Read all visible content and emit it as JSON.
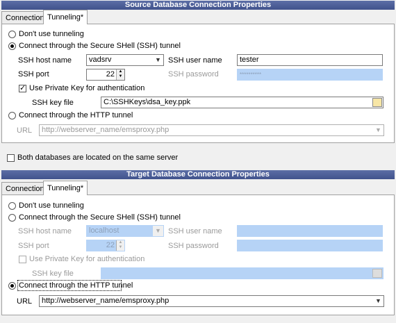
{
  "source": {
    "title": "Source Database Connection Properties",
    "tabs": [
      "Connection",
      "Tunneling*"
    ],
    "options": {
      "no_tunnel": "Don't use tunneling",
      "ssh_tunnel": "Connect through the Secure SHell (SSH) tunnel",
      "http_tunnel": "Connect through the HTTP tunnel"
    },
    "ssh": {
      "host_label": "SSH host name",
      "host_value": "vadsrv",
      "user_label": "SSH user name",
      "user_value": "tester",
      "port_label": "SSH port",
      "port_value": "22",
      "password_label": "SSH password",
      "password_value": "**********",
      "private_key_label": "Use Private Key for authentication",
      "key_file_label": "SSH key file",
      "key_file_value": "C:\\SSHKeys\\dsa_key.ppk"
    },
    "url_label": "URL",
    "url_value": "http://webserver_name/emsproxy.php"
  },
  "same_server_label": "Both databases are located on the same server",
  "target": {
    "title": "Target Database Connection Properties",
    "tabs": [
      "Connection",
      "Tunneling*"
    ],
    "options": {
      "no_tunnel": "Don't use tunneling",
      "ssh_tunnel": "Connect through the Secure SHell (SSH) tunnel",
      "http_tunnel": "Connect through the HTTP tunnel"
    },
    "ssh": {
      "host_label": "SSH host name",
      "host_value": "localhost",
      "user_label": "SSH user name",
      "port_label": "SSH port",
      "port_value": "22",
      "password_label": "SSH password",
      "private_key_label": "Use Private Key for authentication",
      "key_file_label": "SSH key file"
    },
    "url_label": "URL",
    "url_value": "http://webserver_name/emsproxy.php"
  },
  "icons": {
    "dropdown": "▼",
    "spin_up": "▲",
    "spin_down": "▼"
  }
}
